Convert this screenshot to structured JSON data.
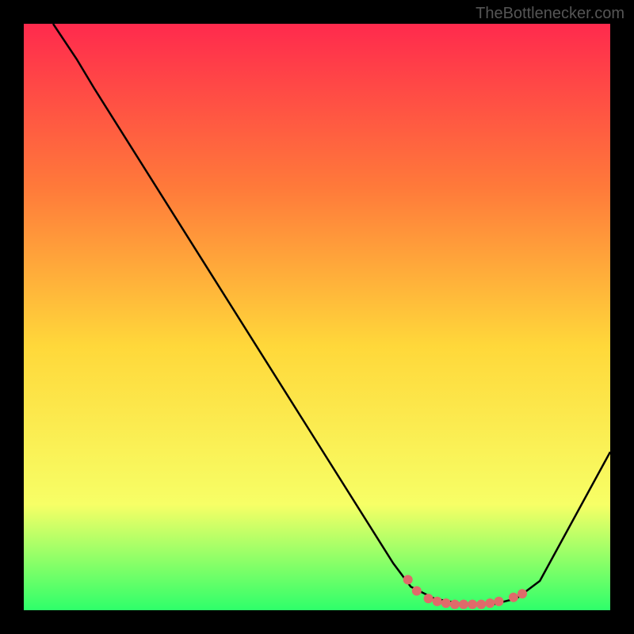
{
  "watermark": "TheBottlenecker.com",
  "chart_data": {
    "type": "line",
    "title": "",
    "xlabel": "",
    "ylabel": "",
    "xlim": [
      0,
      100
    ],
    "ylim": [
      0,
      100
    ],
    "background_gradient": {
      "top": "#ff2a4d",
      "mid_upper": "#ff7a3a",
      "mid": "#ffd83a",
      "mid_lower": "#f7ff66",
      "bottom": "#2eff6a"
    },
    "curve": {
      "color": "#000000",
      "points_percent": [
        [
          5,
          100
        ],
        [
          9,
          94
        ],
        [
          12,
          89
        ],
        [
          63,
          8
        ],
        [
          66,
          4
        ],
        [
          70,
          2
        ],
        [
          75,
          1
        ],
        [
          80,
          1
        ],
        [
          84,
          2
        ],
        [
          88,
          5
        ],
        [
          100,
          27
        ]
      ]
    },
    "markers": {
      "color": "#e06a6a",
      "radius_px": 6,
      "points_percent": [
        [
          65.5,
          5.2
        ],
        [
          67.0,
          3.3
        ],
        [
          69.0,
          2.0
        ],
        [
          70.5,
          1.5
        ],
        [
          72.0,
          1.2
        ],
        [
          73.5,
          1.0
        ],
        [
          75.0,
          1.0
        ],
        [
          76.5,
          1.0
        ],
        [
          78.0,
          1.0
        ],
        [
          79.5,
          1.2
        ],
        [
          81.0,
          1.5
        ],
        [
          83.5,
          2.2
        ],
        [
          85.0,
          2.8
        ]
      ]
    }
  }
}
